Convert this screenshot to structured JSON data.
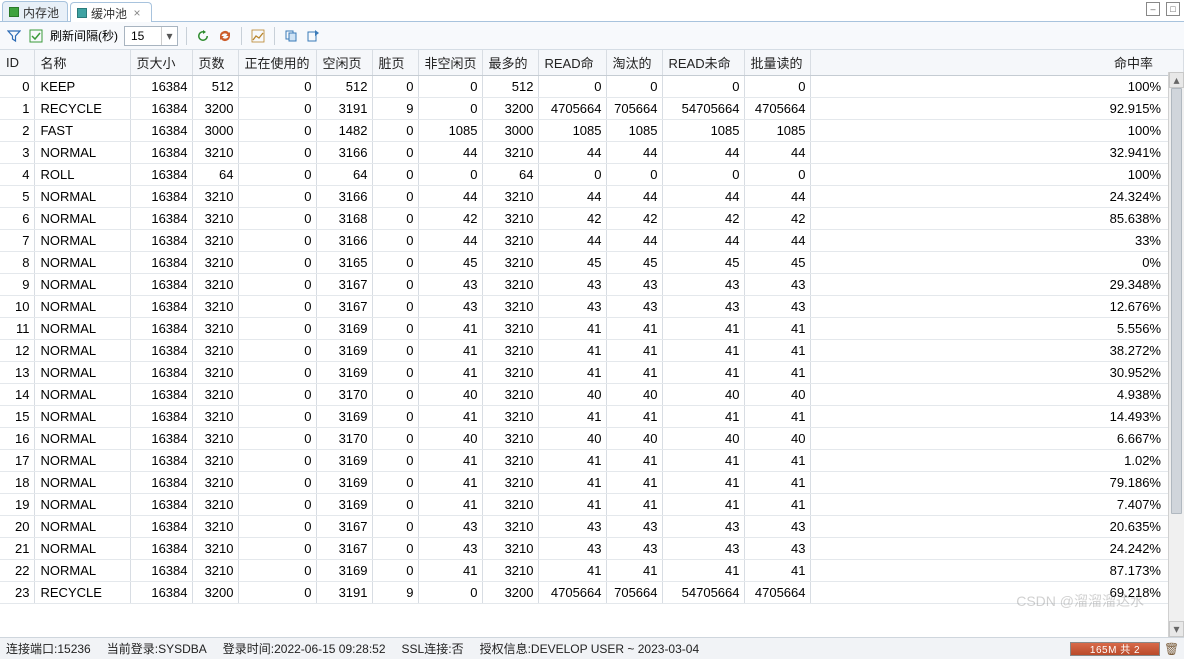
{
  "tabs": [
    {
      "label": "内存池",
      "active": false
    },
    {
      "label": "缓冲池",
      "active": true
    }
  ],
  "toolbar": {
    "refresh_label": "刷新间隔(秒)",
    "refresh_value": "15"
  },
  "table": {
    "headers": {
      "id": "ID",
      "name": "名称",
      "page_size": "页大小",
      "pages": "页数",
      "in_use": "正在使用的",
      "free": "空闲页",
      "dirty": "脏页",
      "non_free": "非空闲页",
      "most": "最多的",
      "read_hit": "READ命",
      "evict": "淘汰的",
      "read_miss": "READ未命",
      "batch": "批量读的",
      "hit_rate": "命中率"
    },
    "rows": [
      {
        "id": 0,
        "name": "KEEP",
        "page_size": 16384,
        "pages": 512,
        "in_use": 0,
        "free": 512,
        "dirty": 0,
        "non_free": 0,
        "most": 512,
        "read_hit": "0",
        "evict": "0",
        "read_miss": "0",
        "batch": "0",
        "hit_rate": "100%"
      },
      {
        "id": 1,
        "name": "RECYCLE",
        "page_size": 16384,
        "pages": 3200,
        "in_use": 0,
        "free": 3191,
        "dirty": 9,
        "non_free": 0,
        "most": 3200,
        "read_hit": "4705664",
        "evict": "705664",
        "read_miss": "54705664",
        "batch": "4705664",
        "hit_rate": "92.915%"
      },
      {
        "id": 2,
        "name": "FAST",
        "page_size": 16384,
        "pages": 3000,
        "in_use": 0,
        "free": 1482,
        "dirty": 0,
        "non_free": 1085,
        "most": 3000,
        "read_hit": "1085",
        "evict": "1085",
        "read_miss": "1085",
        "batch": "1085",
        "hit_rate": "100%"
      },
      {
        "id": 3,
        "name": "NORMAL",
        "page_size": 16384,
        "pages": 3210,
        "in_use": 0,
        "free": 3166,
        "dirty": 0,
        "non_free": 44,
        "most": 3210,
        "read_hit": "44",
        "evict": "44",
        "read_miss": "44",
        "batch": "44",
        "hit_rate": "32.941%"
      },
      {
        "id": 4,
        "name": "ROLL",
        "page_size": 16384,
        "pages": 64,
        "in_use": 0,
        "free": 64,
        "dirty": 0,
        "non_free": 0,
        "most": 64,
        "read_hit": "0",
        "evict": "0",
        "read_miss": "0",
        "batch": "0",
        "hit_rate": "100%"
      },
      {
        "id": 5,
        "name": "NORMAL",
        "page_size": 16384,
        "pages": 3210,
        "in_use": 0,
        "free": 3166,
        "dirty": 0,
        "non_free": 44,
        "most": 3210,
        "read_hit": "44",
        "evict": "44",
        "read_miss": "44",
        "batch": "44",
        "hit_rate": "24.324%"
      },
      {
        "id": 6,
        "name": "NORMAL",
        "page_size": 16384,
        "pages": 3210,
        "in_use": 0,
        "free": 3168,
        "dirty": 0,
        "non_free": 42,
        "most": 3210,
        "read_hit": "42",
        "evict": "42",
        "read_miss": "42",
        "batch": "42",
        "hit_rate": "85.638%"
      },
      {
        "id": 7,
        "name": "NORMAL",
        "page_size": 16384,
        "pages": 3210,
        "in_use": 0,
        "free": 3166,
        "dirty": 0,
        "non_free": 44,
        "most": 3210,
        "read_hit": "44",
        "evict": "44",
        "read_miss": "44",
        "batch": "44",
        "hit_rate": "33%"
      },
      {
        "id": 8,
        "name": "NORMAL",
        "page_size": 16384,
        "pages": 3210,
        "in_use": 0,
        "free": 3165,
        "dirty": 0,
        "non_free": 45,
        "most": 3210,
        "read_hit": "45",
        "evict": "45",
        "read_miss": "45",
        "batch": "45",
        "hit_rate": "0%"
      },
      {
        "id": 9,
        "name": "NORMAL",
        "page_size": 16384,
        "pages": 3210,
        "in_use": 0,
        "free": 3167,
        "dirty": 0,
        "non_free": 43,
        "most": 3210,
        "read_hit": "43",
        "evict": "43",
        "read_miss": "43",
        "batch": "43",
        "hit_rate": "29.348%"
      },
      {
        "id": 10,
        "name": "NORMAL",
        "page_size": 16384,
        "pages": 3210,
        "in_use": 0,
        "free": 3167,
        "dirty": 0,
        "non_free": 43,
        "most": 3210,
        "read_hit": "43",
        "evict": "43",
        "read_miss": "43",
        "batch": "43",
        "hit_rate": "12.676%"
      },
      {
        "id": 11,
        "name": "NORMAL",
        "page_size": 16384,
        "pages": 3210,
        "in_use": 0,
        "free": 3169,
        "dirty": 0,
        "non_free": 41,
        "most": 3210,
        "read_hit": "41",
        "evict": "41",
        "read_miss": "41",
        "batch": "41",
        "hit_rate": "5.556%"
      },
      {
        "id": 12,
        "name": "NORMAL",
        "page_size": 16384,
        "pages": 3210,
        "in_use": 0,
        "free": 3169,
        "dirty": 0,
        "non_free": 41,
        "most": 3210,
        "read_hit": "41",
        "evict": "41",
        "read_miss": "41",
        "batch": "41",
        "hit_rate": "38.272%"
      },
      {
        "id": 13,
        "name": "NORMAL",
        "page_size": 16384,
        "pages": 3210,
        "in_use": 0,
        "free": 3169,
        "dirty": 0,
        "non_free": 41,
        "most": 3210,
        "read_hit": "41",
        "evict": "41",
        "read_miss": "41",
        "batch": "41",
        "hit_rate": "30.952%"
      },
      {
        "id": 14,
        "name": "NORMAL",
        "page_size": 16384,
        "pages": 3210,
        "in_use": 0,
        "free": 3170,
        "dirty": 0,
        "non_free": 40,
        "most": 3210,
        "read_hit": "40",
        "evict": "40",
        "read_miss": "40",
        "batch": "40",
        "hit_rate": "4.938%"
      },
      {
        "id": 15,
        "name": "NORMAL",
        "page_size": 16384,
        "pages": 3210,
        "in_use": 0,
        "free": 3169,
        "dirty": 0,
        "non_free": 41,
        "most": 3210,
        "read_hit": "41",
        "evict": "41",
        "read_miss": "41",
        "batch": "41",
        "hit_rate": "14.493%"
      },
      {
        "id": 16,
        "name": "NORMAL",
        "page_size": 16384,
        "pages": 3210,
        "in_use": 0,
        "free": 3170,
        "dirty": 0,
        "non_free": 40,
        "most": 3210,
        "read_hit": "40",
        "evict": "40",
        "read_miss": "40",
        "batch": "40",
        "hit_rate": "6.667%"
      },
      {
        "id": 17,
        "name": "NORMAL",
        "page_size": 16384,
        "pages": 3210,
        "in_use": 0,
        "free": 3169,
        "dirty": 0,
        "non_free": 41,
        "most": 3210,
        "read_hit": "41",
        "evict": "41",
        "read_miss": "41",
        "batch": "41",
        "hit_rate": "1.02%"
      },
      {
        "id": 18,
        "name": "NORMAL",
        "page_size": 16384,
        "pages": 3210,
        "in_use": 0,
        "free": 3169,
        "dirty": 0,
        "non_free": 41,
        "most": 3210,
        "read_hit": "41",
        "evict": "41",
        "read_miss": "41",
        "batch": "41",
        "hit_rate": "79.186%"
      },
      {
        "id": 19,
        "name": "NORMAL",
        "page_size": 16384,
        "pages": 3210,
        "in_use": 0,
        "free": 3169,
        "dirty": 0,
        "non_free": 41,
        "most": 3210,
        "read_hit": "41",
        "evict": "41",
        "read_miss": "41",
        "batch": "41",
        "hit_rate": "7.407%"
      },
      {
        "id": 20,
        "name": "NORMAL",
        "page_size": 16384,
        "pages": 3210,
        "in_use": 0,
        "free": 3167,
        "dirty": 0,
        "non_free": 43,
        "most": 3210,
        "read_hit": "43",
        "evict": "43",
        "read_miss": "43",
        "batch": "43",
        "hit_rate": "20.635%"
      },
      {
        "id": 21,
        "name": "NORMAL",
        "page_size": 16384,
        "pages": 3210,
        "in_use": 0,
        "free": 3167,
        "dirty": 0,
        "non_free": 43,
        "most": 3210,
        "read_hit": "43",
        "evict": "43",
        "read_miss": "43",
        "batch": "43",
        "hit_rate": "24.242%"
      },
      {
        "id": 22,
        "name": "NORMAL",
        "page_size": 16384,
        "pages": 3210,
        "in_use": 0,
        "free": 3169,
        "dirty": 0,
        "non_free": 41,
        "most": 3210,
        "read_hit": "41",
        "evict": "41",
        "read_miss": "41",
        "batch": "41",
        "hit_rate": "87.173%"
      },
      {
        "id": 23,
        "name": "RECYCLE",
        "page_size": 16384,
        "pages": 3200,
        "in_use": 0,
        "free": 3191,
        "dirty": 9,
        "non_free": 0,
        "most": 3200,
        "read_hit": "4705664",
        "evict": "705664",
        "read_miss": "54705664",
        "batch": "4705664",
        "hit_rate": "69.218%"
      }
    ]
  },
  "status": {
    "port_label": "连接端口:",
    "port": "15236",
    "login_label": "当前登录:",
    "login": "SYSDBA",
    "login_time_label": "登录时间:",
    "login_time": "2022-06-15 09:28:52",
    "ssl_label": "SSL连接:",
    "ssl": "否",
    "auth_label": "授权信息:",
    "auth": "DEVELOP USER ~ 2023-03-04",
    "memory": "165M 共 2"
  },
  "watermark": "CSDN @溜溜溜达水"
}
